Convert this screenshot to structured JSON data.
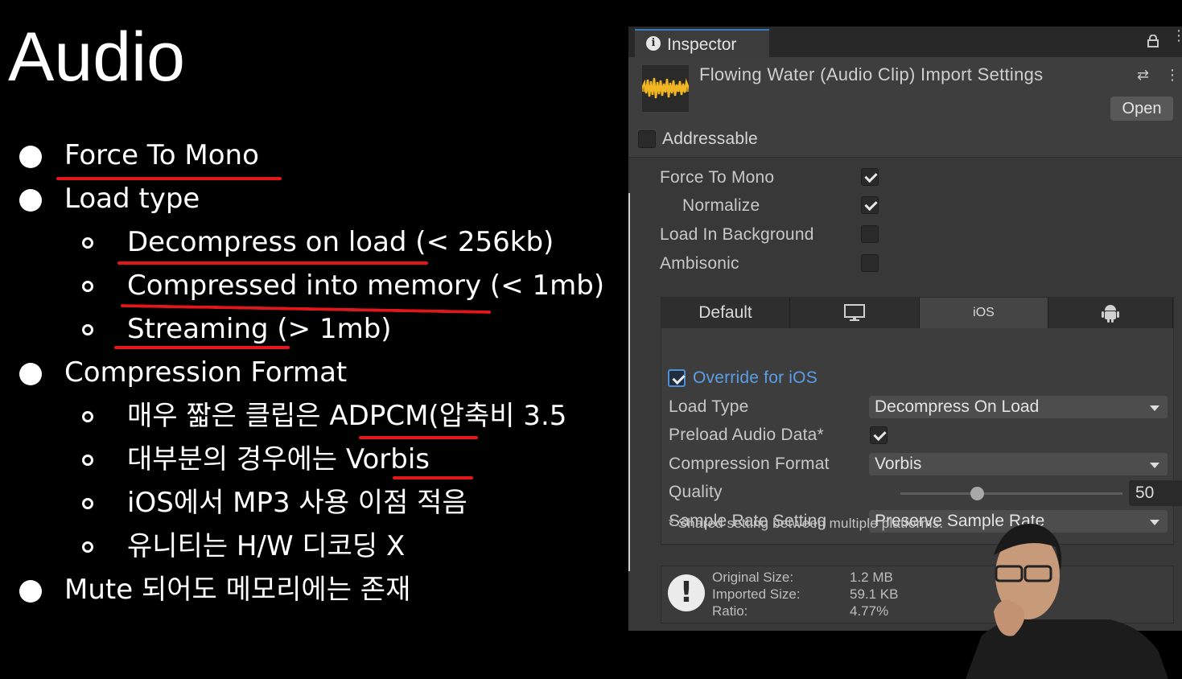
{
  "slide": {
    "title": "Audio",
    "bullets": [
      {
        "text": "Force To Mono"
      },
      {
        "text": "Load type"
      },
      {
        "text": "Decompress on load (< 256kb)"
      },
      {
        "text": "Compressed into memory (< 1mb)"
      },
      {
        "text": "Streaming (> 1mb)"
      },
      {
        "text": "Compression Format"
      },
      {
        "text": "매우 짧은 클립은 ADPCM(압축비 3.5"
      },
      {
        "text": "대부분의 경우에는 Vorbis"
      },
      {
        "text": "iOS에서 MP3 사용 이점 적음"
      },
      {
        "text": "유니티는 H/W 디코딩 X"
      },
      {
        "text": "Mute 되어도 메모리에는 존재"
      }
    ],
    "annotation_color": "#e3161c"
  },
  "inspector": {
    "tab_label": "Inspector",
    "tab_icon": "info-icon",
    "title": "Flowing Water (Audio Clip) Import Settings",
    "open_button": "Open",
    "addressable_label": "Addressable",
    "addressable_checked": false,
    "options": [
      {
        "label": "Force To Mono",
        "checked": true
      },
      {
        "label": "Normalize",
        "checked": true
      },
      {
        "label": "Load In Background",
        "checked": false
      },
      {
        "label": "Ambisonic",
        "checked": false
      }
    ],
    "platform_tabs": [
      {
        "label": "Default",
        "icon": null
      },
      {
        "label": "",
        "icon": "monitor-icon"
      },
      {
        "label": "iOS",
        "icon": null
      },
      {
        "label": "",
        "icon": "android-icon"
      }
    ],
    "selected_platform": "iOS",
    "override_label": "Override for iOS",
    "override_checked": true,
    "load_type_label": "Load Type",
    "load_type_value": "Decompress On Load",
    "preload_label": "Preload Audio Data*",
    "preload_checked": true,
    "compression_label": "Compression Format",
    "compression_value": "Vorbis",
    "quality_label": "Quality",
    "quality_value": "50",
    "quality_fraction": 0.5,
    "sample_rate_label": "Sample Rate Setting",
    "sample_rate_value": "Preserve Sample Rate",
    "shared_note": "* Shared setting between multiple platforms.",
    "info": {
      "original_label": "Original Size:",
      "original_value": "1.2 MB",
      "imported_label": "Imported Size:",
      "imported_value": "59.1 KB",
      "ratio_label": "Ratio:",
      "ratio_value": "4.77%"
    },
    "accent": "#3a79bb"
  }
}
